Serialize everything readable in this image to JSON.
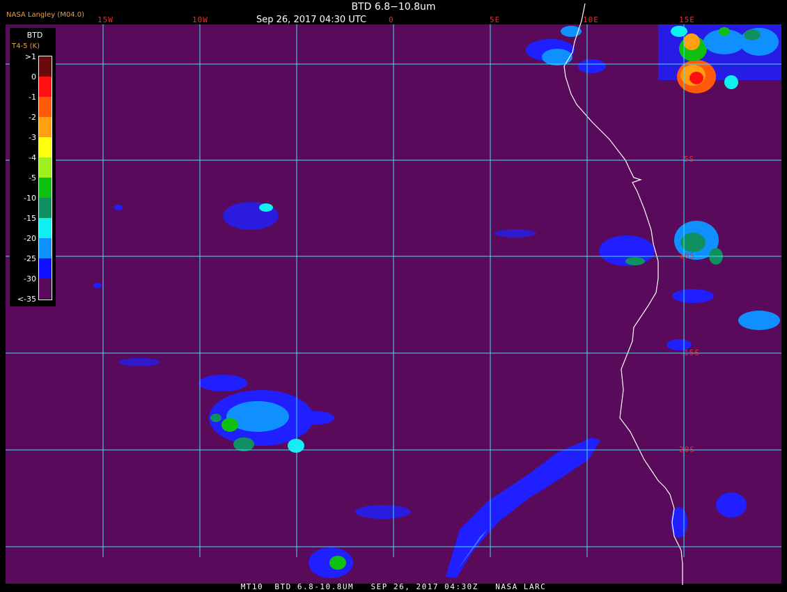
{
  "header": {
    "organization": "NASA Langley (M04.0)",
    "title": "BTD 6.8−10.8um",
    "timestamp": "Sep 26, 2017 04:30 UTC"
  },
  "footer": {
    "text": "MT10  BTD 6.8-10.8UM   SEP 26, 2017 04:30Z   NASA LARC"
  },
  "longitude_labels": [
    "15W",
    "10W",
    "0",
    "5E",
    "10E",
    "15E"
  ],
  "latitude_labels": [
    "5S",
    "10S",
    "15S",
    "20S"
  ],
  "legend": {
    "title": "BTD",
    "units": "T4-5 (K)",
    "ticks": [
      ">1",
      "0",
      "-1",
      "-2",
      "-3",
      "-4",
      "-5",
      "-10",
      "-15",
      "-20",
      "-25",
      "-30",
      "<-35"
    ],
    "colors": [
      "#6b0a0a",
      "#ff1010",
      "#ff5a0a",
      "#ffa010",
      "#ffff10",
      "#a0f020",
      "#10c010",
      "#109060",
      "#10f0f0",
      "#1090ff",
      "#1010ff",
      "#5a0a5a"
    ]
  },
  "colors": {
    "background": "#5a0a5a",
    "grid": "#40e0ff",
    "coastline": "#ffffff",
    "label_red": "#e03030",
    "label_orange": "#e8a040"
  }
}
